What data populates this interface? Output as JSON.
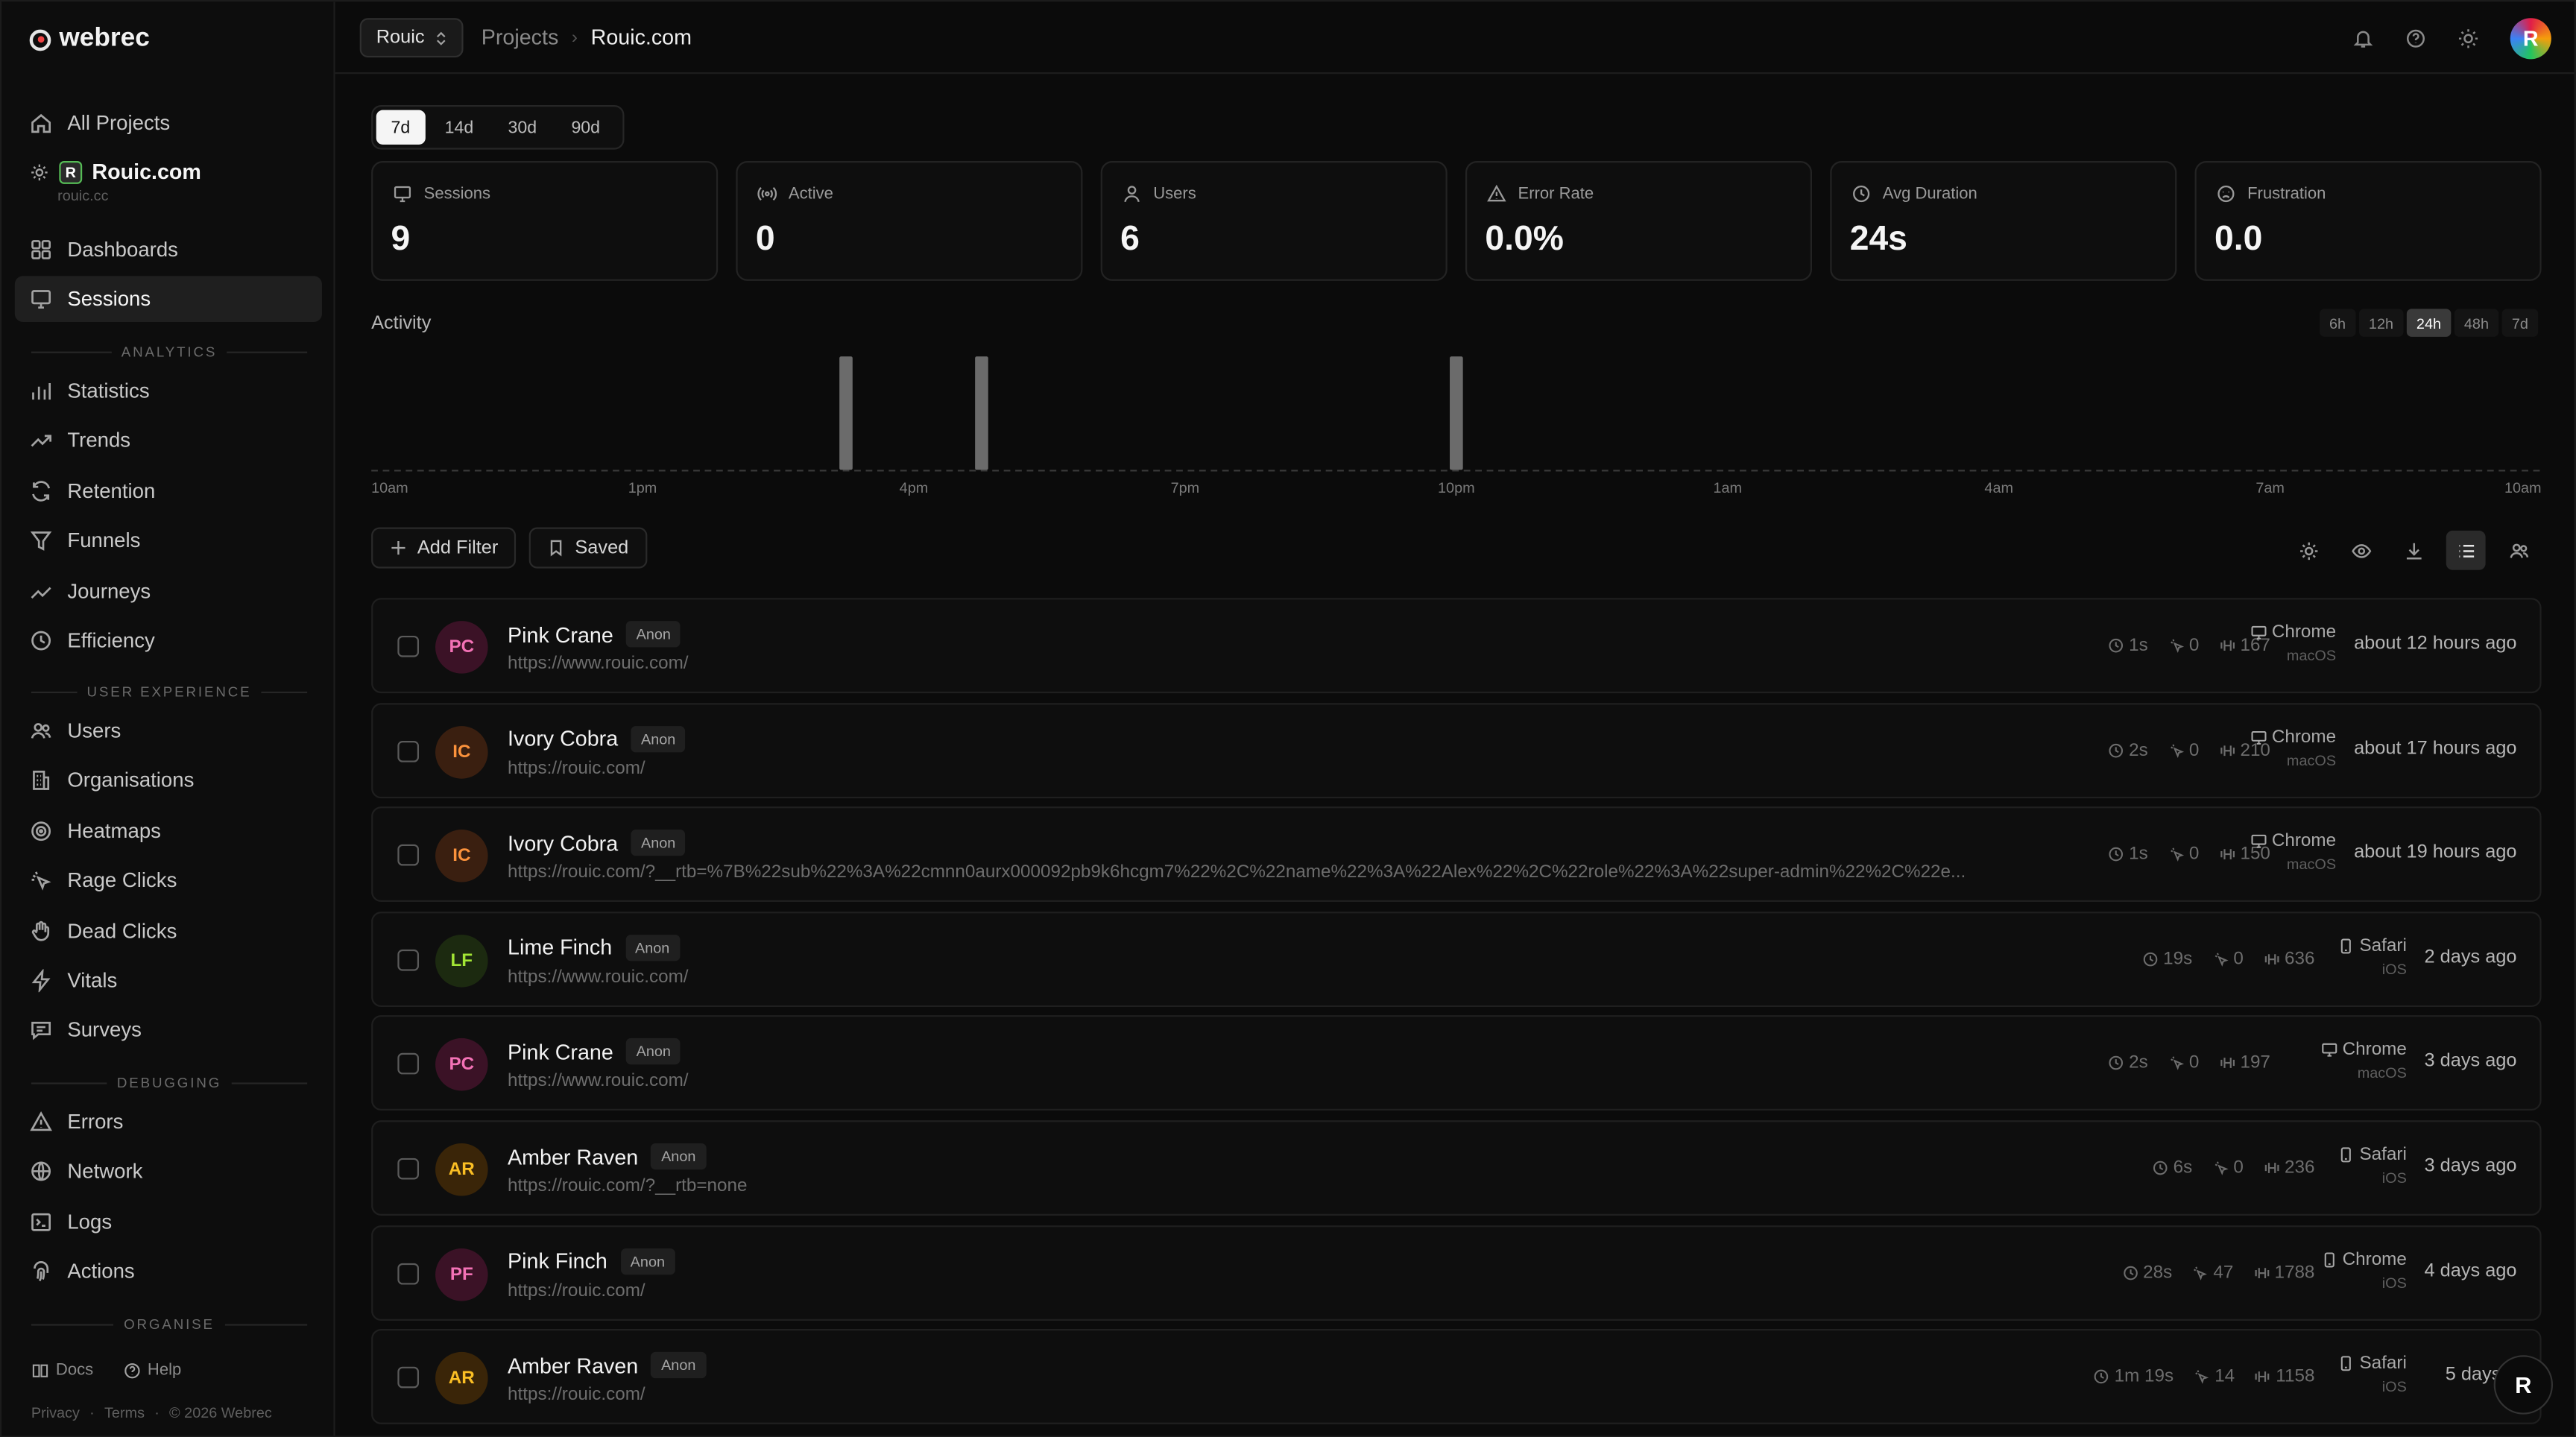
{
  "brand": {
    "name": "webrec"
  },
  "sidebar": {
    "all_projects": "All Projects",
    "project": {
      "name": "Rouic.com",
      "domain": "rouic.cc",
      "logo": "R"
    },
    "top_items": [
      {
        "label": "Dashboards",
        "icon": "dashboard-icon"
      },
      {
        "label": "Sessions",
        "icon": "monitor-icon",
        "active": true
      }
    ],
    "sections": [
      {
        "label": "ANALYTICS",
        "items": [
          {
            "label": "Statistics",
            "icon": "bar-chart-icon"
          },
          {
            "label": "Trends",
            "icon": "trend-icon"
          },
          {
            "label": "Retention",
            "icon": "refresh-icon"
          },
          {
            "label": "Funnels",
            "icon": "funnel-icon"
          },
          {
            "label": "Journeys",
            "icon": "route-icon"
          },
          {
            "label": "Efficiency",
            "icon": "clock-icon"
          }
        ]
      },
      {
        "label": "USER EXPERIENCE",
        "items": [
          {
            "label": "Users",
            "icon": "users-icon"
          },
          {
            "label": "Organisations",
            "icon": "building-icon"
          },
          {
            "label": "Heatmaps",
            "icon": "heatmap-icon"
          },
          {
            "label": "Rage Clicks",
            "icon": "rage-click-icon"
          },
          {
            "label": "Dead Clicks",
            "icon": "hand-icon"
          },
          {
            "label": "Vitals",
            "icon": "bolt-icon"
          },
          {
            "label": "Surveys",
            "icon": "message-icon"
          }
        ]
      },
      {
        "label": "DEBUGGING",
        "items": [
          {
            "label": "Errors",
            "icon": "warning-icon"
          },
          {
            "label": "Network",
            "icon": "globe-icon"
          },
          {
            "label": "Logs",
            "icon": "terminal-icon"
          },
          {
            "label": "Actions",
            "icon": "fingerprint-icon"
          }
        ]
      },
      {
        "label": "ORGANISE",
        "items": []
      }
    ],
    "footer": {
      "docs": "Docs",
      "help": "Help",
      "privacy": "Privacy",
      "terms": "Terms",
      "copyright": "© 2026 Webrec",
      "sep": "·"
    }
  },
  "topbar": {
    "project_select": "Rouic",
    "breadcrumb": {
      "projects": "Projects",
      "current": "Rouic.com",
      "separator": "›"
    },
    "avatar": "R"
  },
  "range_tabs": [
    {
      "label": "7d",
      "active": true
    },
    {
      "label": "14d"
    },
    {
      "label": "30d"
    },
    {
      "label": "90d"
    }
  ],
  "stats": [
    {
      "label": "Sessions",
      "value": "9",
      "icon": "monitor-icon"
    },
    {
      "label": "Active",
      "value": "0",
      "icon": "live-icon"
    },
    {
      "label": "Users",
      "value": "6",
      "icon": "user-icon"
    },
    {
      "label": "Error Rate",
      "value": "0.0%",
      "icon": "warning-icon"
    },
    {
      "label": "Avg Duration",
      "value": "24s",
      "icon": "clock-icon"
    },
    {
      "label": "Frustration",
      "value": "0.0",
      "icon": "frustration-icon"
    }
  ],
  "activity": {
    "title": "Activity",
    "granularity": [
      {
        "label": "6h"
      },
      {
        "label": "12h"
      },
      {
        "label": "24h",
        "active": true
      },
      {
        "label": "48h"
      },
      {
        "label": "7d"
      }
    ]
  },
  "chart_data": {
    "type": "bar",
    "title": "Activity",
    "x_tick_labels": [
      "10am",
      "1pm",
      "4pm",
      "7pm",
      "10pm",
      "1am",
      "4am",
      "7am",
      "10am"
    ],
    "x_domain_hours": 24,
    "bars": [
      {
        "hour_offset": 5.25,
        "value": 1
      },
      {
        "hour_offset": 6.75,
        "value": 1
      },
      {
        "hour_offset": 12.0,
        "value": 1
      }
    ],
    "ylim": [
      0,
      1
    ],
    "grid": false
  },
  "toolbar": {
    "add_filter": "Add Filter",
    "saved": "Saved"
  },
  "sessions": [
    {
      "name": "Pink Crane",
      "initials": "PC",
      "badge": "Anon",
      "url": "https://www.rouic.com/",
      "duration": "1s",
      "clicks": "0",
      "events": "167",
      "browser": "Chrome",
      "os": "macOS",
      "device": "desktop",
      "ago": "about 12 hours ago",
      "color": "#f472b6",
      "bg": "#3b1226"
    },
    {
      "name": "Ivory Cobra",
      "initials": "IC",
      "badge": "Anon",
      "url": "https://rouic.com/",
      "duration": "2s",
      "clicks": "0",
      "events": "210",
      "browser": "Chrome",
      "os": "macOS",
      "device": "desktop",
      "ago": "about 17 hours ago",
      "color": "#fb923c",
      "bg": "#3a1f10"
    },
    {
      "name": "Ivory Cobra",
      "initials": "IC",
      "badge": "Anon",
      "url": "https://rouic.com/?__rtb=%7B%22sub%22%3A%22cmnn0aurx000092pb9k6hcgm7%22%2C%22name%22%3A%22Alex%22%2C%22role%22%3A%22super-admin%22%2C%22e...",
      "duration": "1s",
      "clicks": "0",
      "events": "150",
      "browser": "Chrome",
      "os": "macOS",
      "device": "desktop",
      "ago": "about 19 hours ago",
      "color": "#fb923c",
      "bg": "#3a1f10"
    },
    {
      "name": "Lime Finch",
      "initials": "LF",
      "badge": "Anon",
      "url": "https://www.rouic.com/",
      "duration": "19s",
      "clicks": "0",
      "events": "636",
      "browser": "Safari",
      "os": "iOS",
      "device": "mobile",
      "ago": "2 days ago",
      "color": "#a3e635",
      "bg": "#1c2a10"
    },
    {
      "name": "Pink Crane",
      "initials": "PC",
      "badge": "Anon",
      "url": "https://www.rouic.com/",
      "duration": "2s",
      "clicks": "0",
      "events": "197",
      "browser": "Chrome",
      "os": "macOS",
      "device": "desktop",
      "ago": "3 days ago",
      "color": "#f472b6",
      "bg": "#3b1226"
    },
    {
      "name": "Amber Raven",
      "initials": "AR",
      "badge": "Anon",
      "url": "https://rouic.com/?__rtb=none",
      "duration": "6s",
      "clicks": "0",
      "events": "236",
      "browser": "Safari",
      "os": "iOS",
      "device": "mobile",
      "ago": "3 days ago",
      "color": "#fbbf24",
      "bg": "#3a2508"
    },
    {
      "name": "Pink Finch",
      "initials": "PF",
      "badge": "Anon",
      "url": "https://rouic.com/",
      "duration": "28s",
      "clicks": "47",
      "events": "1788",
      "browser": "Chrome",
      "os": "iOS",
      "device": "mobile",
      "ago": "4 days ago",
      "color": "#f472b6",
      "bg": "#3b1226"
    },
    {
      "name": "Amber Raven",
      "initials": "AR",
      "badge": "Anon",
      "url": "https://rouic.com/",
      "duration": "1m 19s",
      "clicks": "14",
      "events": "1158",
      "browser": "Safari",
      "os": "iOS",
      "device": "mobile",
      "ago": "5 days a",
      "color": "#fbbf24",
      "bg": "#3a2508"
    }
  ],
  "fab": {
    "label": "R"
  }
}
